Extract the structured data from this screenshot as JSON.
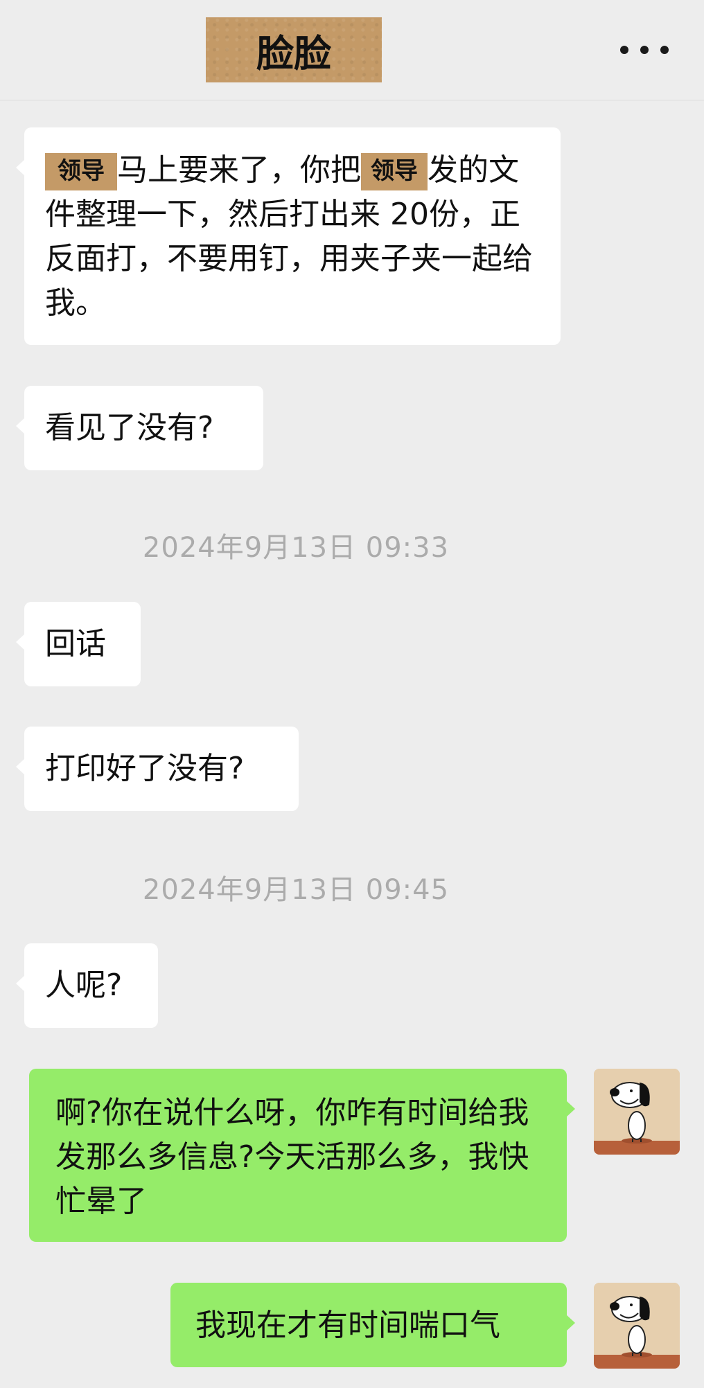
{
  "header": {
    "title": "脸脸"
  },
  "messages": {
    "m1": {
      "tag1": "领导",
      "text1": "马上要来了，你把",
      "tag2": "领导",
      "text2": "发的文件整理一下，然后打出来 20份，正反面打，不要用钉，用夹子夹一起给我。"
    },
    "m2": "看见了没有?",
    "ts1": "2024年9月13日 09:33",
    "m3": "回话",
    "m4": "打印好了没有?",
    "ts2": "2024年9月13日 09:45",
    "m5": "人呢?",
    "m6": "啊?你在说什么呀，你咋有时间给我发那么多信息?今天活那么多，我快忙晕了",
    "m7": "我现在才有时间喘口气"
  },
  "icons": {
    "more": "more-dots-icon",
    "avatar": "snoopy-avatar"
  },
  "colors": {
    "background": "#ededed",
    "incoming_bubble": "#ffffff",
    "outgoing_bubble": "#95ec69",
    "name_tag": "#c49a67",
    "timestamp": "#ababab"
  }
}
